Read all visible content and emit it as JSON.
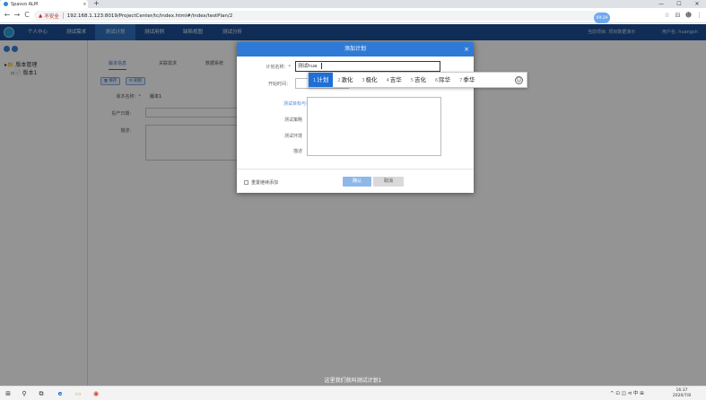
{
  "browser": {
    "tab_title": "Spasvo ALM",
    "tab_close": "×",
    "new_tab": "+",
    "window_controls": [
      "—",
      "☐",
      "✕"
    ],
    "nav": [
      "←",
      "→",
      "C"
    ],
    "security_text": "不安全",
    "url": "192.168.1.123:8019/ProjectCenter/tc/index.html#/index/testPlan/2",
    "profile_label": "09:29",
    "right_icons": [
      "☆",
      "⊟",
      "☻",
      "⋮"
    ]
  },
  "app": {
    "menus": [
      "个人中心",
      "测试需求",
      "测试计划",
      "测试用例",
      "缺陷视图",
      "测试分析"
    ],
    "active_menu_index": 2,
    "project_label": "当前项目: 项目数据演示",
    "user_label": "用户名: huangsh"
  },
  "tree": {
    "root": "版本管理",
    "child": "版本1"
  },
  "main": {
    "subtabs": [
      "版本信息",
      "关联需求",
      "数据系统"
    ],
    "buttons": [
      "保存",
      "刷新"
    ],
    "fields": [
      {
        "label": "版本名称：*",
        "value": "版本1"
      },
      {
        "label": "投产日期:",
        "value": ""
      },
      {
        "label": "描述:",
        "value": ""
      }
    ]
  },
  "dialog": {
    "title": "添加计划",
    "close": "×",
    "name_label": "计划名称：",
    "required_mark": "*",
    "name_value": "测试hua",
    "start_label": "开始时间：",
    "goal_label": "测试目标与范围",
    "strategy_label": "测试策略",
    "env_label": "测试环境",
    "desc_label": "描述",
    "continue_label": "重置继续添加",
    "ok_label": "确认",
    "cancel_label": "取消"
  },
  "ime": {
    "candidates": [
      {
        "n": "1",
        "text": "计划"
      },
      {
        "n": "2",
        "text": "激化"
      },
      {
        "n": "3",
        "text": "极化"
      },
      {
        "n": "4",
        "text": "吉华"
      },
      {
        "n": "5",
        "text": "吉化"
      },
      {
        "n": "6",
        "text": "际华"
      },
      {
        "n": "7",
        "text": "季华"
      }
    ],
    "selected_index": 0,
    "emoji": "☺"
  },
  "subtitle": "这里我们就叫测试计划1",
  "taskbar": {
    "icons": [
      "⊞",
      "⚲",
      "⧉",
      "e",
      "▭",
      "◉"
    ],
    "tray": "^ ⊡ ◫ ⊲ 中 ⊞",
    "time": "16:37",
    "date": "2020/7/8"
  },
  "colors": {
    "header": "#1c4f96",
    "dialog_header": "#2f7ad6",
    "ime_selected": "#1f6fd6"
  }
}
